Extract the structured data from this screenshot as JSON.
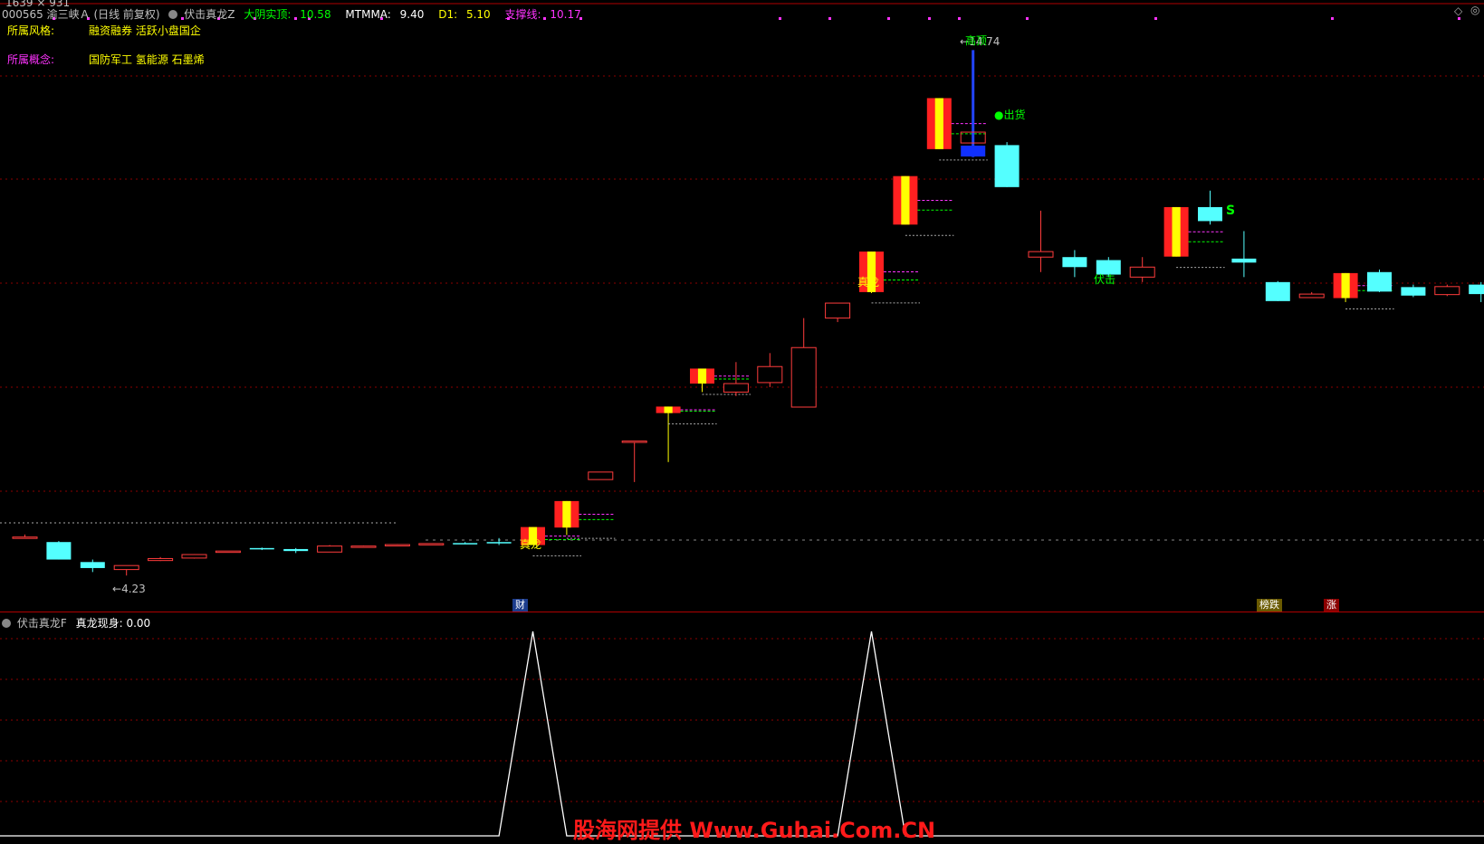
{
  "dims": "1639 × 931",
  "header": {
    "stock": "000565 渝三峡Ａ (日线 前复权)",
    "indicator": "伏击真龙Z",
    "fields": [
      {
        "label": "大阴实顶:",
        "value": "10.58",
        "color": "#00ff00"
      },
      {
        "label": "MTMMA:",
        "value": "9.40",
        "color": "#ffffff"
      },
      {
        "label": "D1:",
        "value": "5.10",
        "color": "#ffff00"
      },
      {
        "label": "支撑线:",
        "value": "10.17",
        "color": "#ff33ff"
      }
    ]
  },
  "info": {
    "style_label": "所属风格:",
    "style_value": "融资融券 活跃小盘国企",
    "concept_label": "所属概念:",
    "concept_value": "国防军工 氢能源 石墨烯"
  },
  "annotations": {
    "low": "4.23",
    "high": "14.74",
    "top_label": "高顶",
    "exit_label": "出货",
    "dragon_1": "真龙",
    "dragon_2": "真龙",
    "ambush": "伏击",
    "s_mark": "S"
  },
  "badges": {
    "cai": "财",
    "bang_die": "榜跌",
    "zhang": "涨"
  },
  "sub_header": {
    "indicator": "伏击真龙F",
    "field_label": "真龙现身:",
    "field_value": "0.00"
  },
  "watermark": "股海网提供 Www.Guhai.Com.CN",
  "colors": {
    "up": "#ff3c3c",
    "down": "#54ffff",
    "dragon_red": "#ff2020",
    "dragon_yellow": "#ffff00",
    "grid": "#8b0000",
    "magenta": "#ff33ff",
    "green": "#00ff00"
  },
  "chart_data": {
    "type": "candlestick",
    "ylim": [
      3.8,
      15.2
    ],
    "candles": [
      {
        "o": 5.0,
        "h": 5.05,
        "c": 4.98,
        "l": 4.97,
        "dir": "up"
      },
      {
        "o": 4.9,
        "h": 4.92,
        "c": 4.55,
        "l": 4.55,
        "dir": "down"
      },
      {
        "o": 4.5,
        "h": 4.55,
        "c": 4.38,
        "l": 4.3,
        "dir": "down"
      },
      {
        "o": 4.35,
        "h": 4.42,
        "c": 4.43,
        "l": 4.23,
        "dir": "up"
      },
      {
        "o": 4.53,
        "h": 4.6,
        "c": 4.57,
        "l": 4.52,
        "dir": "up"
      },
      {
        "o": 4.58,
        "h": 4.66,
        "c": 4.65,
        "l": 4.57,
        "dir": "up"
      },
      {
        "o": 4.7,
        "h": 4.72,
        "c": 4.72,
        "l": 4.69,
        "dir": "up"
      },
      {
        "o": 4.78,
        "h": 4.79,
        "c": 4.77,
        "l": 4.74,
        "dir": "down"
      },
      {
        "o": 4.76,
        "h": 4.78,
        "c": 4.72,
        "l": 4.68,
        "dir": "down"
      },
      {
        "o": 4.7,
        "h": 4.84,
        "c": 4.82,
        "l": 4.7,
        "dir": "up"
      },
      {
        "o": 4.81,
        "h": 4.83,
        "c": 4.82,
        "l": 4.79,
        "dir": "up"
      },
      {
        "o": 4.83,
        "h": 4.86,
        "c": 4.85,
        "l": 4.83,
        "dir": "up"
      },
      {
        "o": 4.86,
        "h": 4.87,
        "c": 4.87,
        "l": 4.85,
        "dir": "up"
      },
      {
        "o": 4.88,
        "h": 4.9,
        "c": 4.88,
        "l": 4.87,
        "dir": "down"
      },
      {
        "o": 4.88,
        "h": 4.98,
        "c": 4.9,
        "l": 4.84,
        "dir": "down"
      },
      {
        "o": 4.84,
        "h": 5.2,
        "c": 5.2,
        "l": 4.84,
        "dir": "dragon"
      },
      {
        "o": 5.19,
        "h": 5.72,
        "c": 5.72,
        "l": 5.04,
        "dir": "dragon"
      },
      {
        "o": 6.15,
        "h": 6.3,
        "c": 6.3,
        "l": 6.15,
        "dir": "up"
      },
      {
        "o": 6.9,
        "h": 6.92,
        "c": 6.92,
        "l": 6.1,
        "dir": "up"
      },
      {
        "o": 7.48,
        "h": 7.61,
        "c": 7.61,
        "l": 6.5,
        "dir": "dragon"
      },
      {
        "o": 8.07,
        "h": 8.37,
        "c": 8.37,
        "l": 7.9,
        "dir": "dragon"
      },
      {
        "o": 7.9,
        "h": 8.5,
        "c": 8.07,
        "l": 7.82,
        "dir": "up"
      },
      {
        "o": 8.09,
        "h": 8.68,
        "c": 8.41,
        "l": 8.0,
        "dir": "up"
      },
      {
        "o": 7.6,
        "h": 9.38,
        "c": 8.79,
        "l": 7.6,
        "dir": "up"
      },
      {
        "o": 9.38,
        "h": 9.68,
        "c": 9.68,
        "l": 9.3,
        "dir": "up"
      },
      {
        "o": 9.9,
        "h": 10.71,
        "c": 10.71,
        "l": 9.88,
        "dir": "dragon"
      },
      {
        "o": 11.25,
        "h": 12.22,
        "c": 12.22,
        "l": 11.25,
        "dir": "dragon"
      },
      {
        "o": 12.76,
        "h": 13.78,
        "c": 13.78,
        "l": 12.76,
        "dir": "dragon"
      },
      {
        "o": 13.0,
        "h": 14.74,
        "c": 12.83,
        "l": 12.6,
        "dir": "blue"
      },
      {
        "o": 12.84,
        "h": 12.9,
        "c": 12.0,
        "l": 12.0,
        "dir": "down"
      },
      {
        "o": 10.6,
        "h": 11.53,
        "c": 10.71,
        "l": 10.3,
        "dir": "up"
      },
      {
        "o": 10.6,
        "h": 10.74,
        "c": 10.4,
        "l": 10.2,
        "dir": "down"
      },
      {
        "o": 10.54,
        "h": 10.6,
        "c": 10.25,
        "l": 10.2,
        "dir": "down"
      },
      {
        "o": 10.4,
        "h": 10.6,
        "c": 10.2,
        "l": 10.1,
        "dir": "up"
      },
      {
        "o": 10.61,
        "h": 11.6,
        "c": 11.6,
        "l": 10.61,
        "dir": "dragon"
      },
      {
        "o": 11.6,
        "h": 11.93,
        "c": 11.32,
        "l": 11.25,
        "dir": "down"
      },
      {
        "o": 10.57,
        "h": 11.12,
        "c": 10.49,
        "l": 10.2,
        "dir": "down"
      },
      {
        "o": 10.1,
        "h": 10.12,
        "c": 9.72,
        "l": 9.72,
        "dir": "down"
      },
      {
        "o": 9.79,
        "h": 9.9,
        "c": 9.86,
        "l": 9.79,
        "dir": "up"
      },
      {
        "o": 9.78,
        "h": 10.28,
        "c": 10.28,
        "l": 9.7,
        "dir": "dragon"
      },
      {
        "o": 10.3,
        "h": 10.35,
        "c": 9.91,
        "l": 9.9,
        "dir": "down"
      },
      {
        "o": 10.0,
        "h": 10.05,
        "c": 9.83,
        "l": 9.8,
        "dir": "down"
      },
      {
        "o": 9.85,
        "h": 10.05,
        "c": 10.01,
        "l": 9.82,
        "dir": "up"
      },
      {
        "o": 10.05,
        "h": 10.1,
        "c": 9.86,
        "l": 9.7,
        "dir": "down"
      }
    ],
    "signal": {
      "name": "真龙现身",
      "peaks_at_candle": [
        15,
        25
      ],
      "ylim": [
        0,
        1
      ]
    }
  }
}
